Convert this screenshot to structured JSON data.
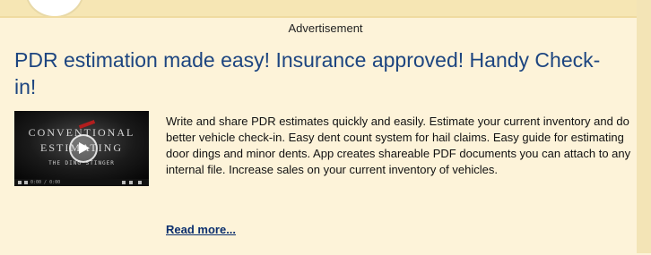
{
  "ad": {
    "label": "Advertisement",
    "headline": "PDR estimation made easy! Insurance approved! Handy Check-in!",
    "thumbnail": {
      "title_line1": "CONVENTIONAL",
      "title_line2": "ESTIMATING",
      "subtitle": "THE DING STINGER",
      "time": "0:00 / 0:00",
      "icon": "play-icon"
    },
    "description": "Write and share PDR estimates quickly and easily. Estimate your current inventory and do better vehicle check-in. Easy dent count system for hail claims. Easy guide for estimating door dings and minor dents. App creates shareable PDF documents you can attach to any internal file. Increase sales on your current inventory of vehicles.",
    "read_more": "Read more..."
  },
  "colors": {
    "background": "#fdf3d9",
    "headline": "#1d4580",
    "link": "#0c2f6e"
  }
}
